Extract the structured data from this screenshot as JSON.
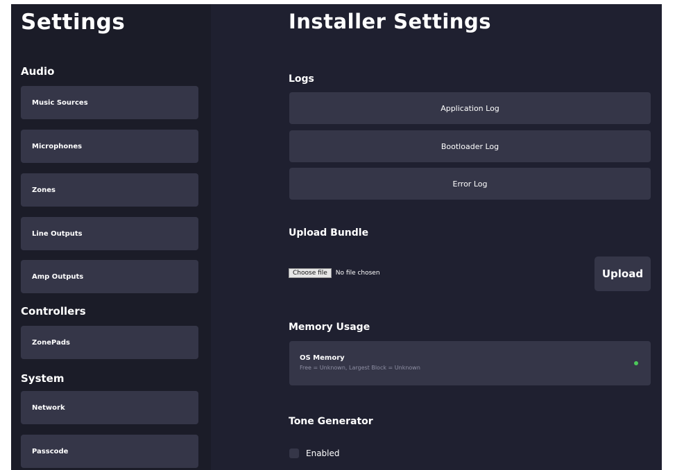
{
  "sidebar": {
    "title": "Settings",
    "sections": {
      "audio": "Audio",
      "controllers": "Controllers",
      "system": "System"
    },
    "items": {
      "music_sources": "Music Sources",
      "microphones": "Microphones",
      "zones": "Zones",
      "line_outputs": "Line Outputs",
      "amp_outputs": "Amp Outputs",
      "zonepads": "ZonePads",
      "network": "Network",
      "passcode": "Passcode"
    }
  },
  "main": {
    "title": "Installer Settings",
    "logs": {
      "heading": "Logs",
      "application_log": "Application Log",
      "bootloader_log": "Bootloader Log",
      "error_log": "Error Log"
    },
    "upload_bundle": {
      "heading": "Upload Bundle",
      "choose_file_label": "Choose file",
      "file_status": "No file chosen",
      "upload_label": "Upload"
    },
    "memory_usage": {
      "heading": "Memory Usage",
      "os_memory_title": "OS Memory",
      "os_memory_detail": "Free = Unknown, Largest Block = Unknown",
      "status_color": "#4cc95a"
    },
    "tone_generator": {
      "heading": "Tone Generator",
      "enabled_label": "Enabled",
      "enabled": false
    }
  },
  "colors": {
    "background": "#1f2030",
    "sidebar": "#1b1c28",
    "button": "#353648"
  }
}
